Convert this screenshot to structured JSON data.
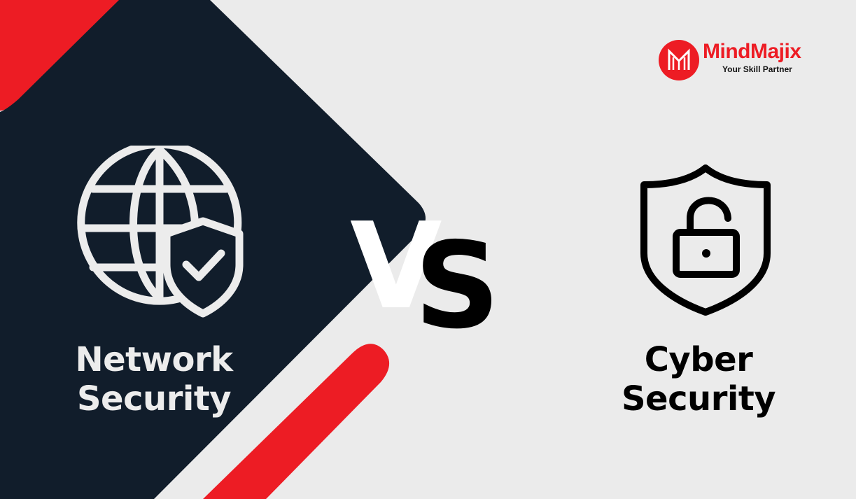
{
  "brand": {
    "name": "MindMajix",
    "tagline": "Your Skill Partner",
    "accent_color": "#ed1c24"
  },
  "left_panel": {
    "icon": "globe-shield-check-icon",
    "title_line1": "Network",
    "title_line2": "Security",
    "bg_color": "#111d2b",
    "text_color": "#ececec"
  },
  "versus": {
    "v": "V",
    "s": "S"
  },
  "right_panel": {
    "icon": "shield-unlock-icon",
    "title_line1": "Cyber",
    "title_line2": "Security",
    "bg_color": "#ebebeb",
    "text_color": "#000000"
  }
}
